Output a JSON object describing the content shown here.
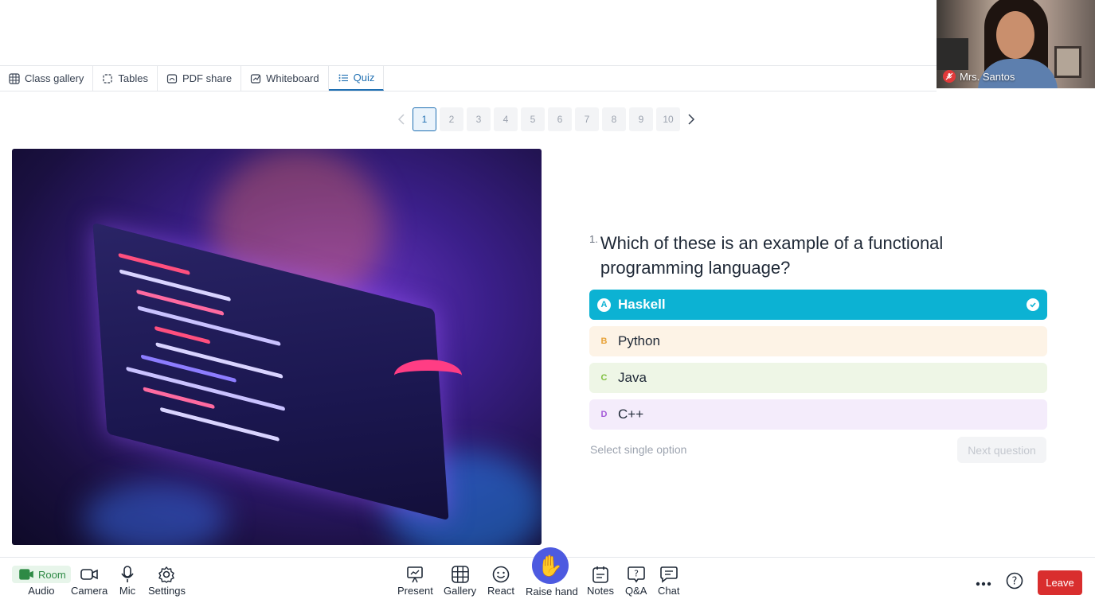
{
  "participant": {
    "name": "Mrs. Santos"
  },
  "tabs": [
    {
      "label": "Class gallery",
      "icon": "grid-icon"
    },
    {
      "label": "Tables",
      "icon": "tables-icon"
    },
    {
      "label": "PDF share",
      "icon": "pdf-icon"
    },
    {
      "label": "Whiteboard",
      "icon": "whiteboard-icon"
    },
    {
      "label": "Quiz",
      "icon": "list-icon",
      "active": true
    }
  ],
  "pagination": {
    "pages": [
      "1",
      "2",
      "3",
      "4",
      "5",
      "6",
      "7",
      "8",
      "9",
      "10"
    ],
    "current": "1"
  },
  "question": {
    "number": "1.",
    "text": "Which of these is an example of a functional programming language?",
    "options": [
      {
        "letter": "A",
        "label": "Haskell",
        "selected": true,
        "bg": "#0cb2d3",
        "fg": "#ffffff",
        "letter_bg": "#ffffff",
        "letter_fg": "#0cb2d3"
      },
      {
        "letter": "B",
        "label": "Python",
        "selected": false,
        "bg": "#fdf3e6",
        "fg": "#1f2937",
        "letter_bg": "#fdf3e6",
        "letter_fg": "#e8a33a"
      },
      {
        "letter": "C",
        "label": "Java",
        "selected": false,
        "bg": "#eef6e6",
        "fg": "#1f2937",
        "letter_bg": "#eef6e6",
        "letter_fg": "#7fbf3f"
      },
      {
        "letter": "D",
        "label": "C++",
        "selected": false,
        "bg": "#f4ecfb",
        "fg": "#1f2937",
        "letter_bg": "#f4ecfb",
        "letter_fg": "#a45ad8"
      }
    ],
    "hint": "Select single option",
    "next_label": "Next question"
  },
  "toolbar": {
    "room_badge": "Room",
    "audio": "Audio",
    "camera": "Camera",
    "mic": "Mic",
    "settings": "Settings",
    "present": "Present",
    "gallery": "Gallery",
    "react": "React",
    "raise_hand": "Raise hand",
    "notes": "Notes",
    "qa": "Q&A",
    "chat": "Chat",
    "leave": "Leave"
  },
  "colors": {
    "accent": "#1f6fb2",
    "leave": "#d92e2e",
    "raise_hand": "#4d5ae0"
  }
}
